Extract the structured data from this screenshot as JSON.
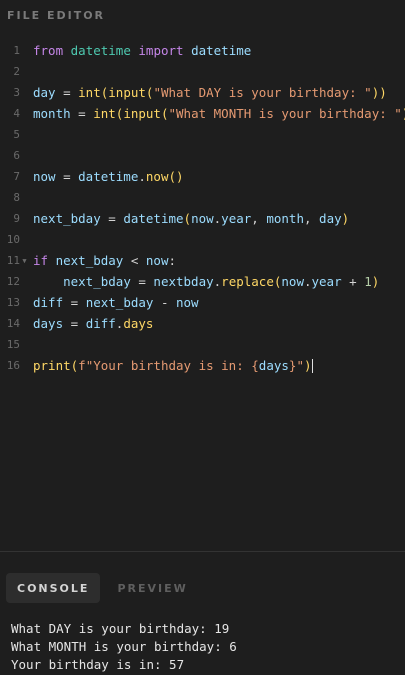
{
  "editor": {
    "header": "FILE EDITOR",
    "lines": [
      {
        "n": "1"
      },
      {
        "n": "2"
      },
      {
        "n": "3"
      },
      {
        "n": "4"
      },
      {
        "n": "5"
      },
      {
        "n": "6"
      },
      {
        "n": "7"
      },
      {
        "n": "8"
      },
      {
        "n": "9"
      },
      {
        "n": "10"
      },
      {
        "n": "11"
      },
      {
        "n": "12"
      },
      {
        "n": "13"
      },
      {
        "n": "14"
      },
      {
        "n": "15"
      },
      {
        "n": "16"
      }
    ],
    "tokens": {
      "l1": [
        "from",
        " ",
        "datetime",
        " ",
        "import",
        " ",
        "datetime"
      ],
      "l3": [
        "day",
        " = ",
        "int",
        "(",
        "input",
        "(",
        "\"What DAY is your birthday: \"",
        "))"
      ],
      "l4": [
        "month",
        " = ",
        "int",
        "(",
        "input",
        "(",
        "\"What MONTH is your birthday: \"",
        "))"
      ],
      "l7": [
        "now",
        " = ",
        "datetime",
        ".",
        "now",
        "()"
      ],
      "l9": [
        "next_bday",
        " = ",
        "datetime",
        "(",
        "now",
        ".",
        "year",
        ", ",
        "month",
        ", ",
        "day",
        ")"
      ],
      "l11": [
        "if",
        " ",
        "next_bday",
        " < ",
        "now",
        ":"
      ],
      "l12": [
        "    ",
        "next_bday",
        " = ",
        "nextbday",
        ".",
        "replace",
        "(",
        "now",
        ".",
        "year",
        " + ",
        "1",
        ")"
      ],
      "l13": [
        "diff",
        " = ",
        "next_bday",
        " - ",
        "now"
      ],
      "l14": [
        "days",
        " = ",
        "diff",
        ".",
        "days"
      ],
      "l16": [
        "print",
        "(",
        "f\"Your birthday is in: ",
        "{",
        "days",
        "}",
        "\"",
        ")"
      ]
    }
  },
  "console": {
    "tabs": [
      {
        "label": "CONSOLE",
        "active": true
      },
      {
        "label": "PREVIEW",
        "active": false
      }
    ],
    "output": [
      "What DAY is your birthday: 19",
      "What MONTH is your birthday: 6",
      "Your birthday is in: 57"
    ]
  },
  "colors": {
    "background": "#1e1e1e",
    "keyword": "#c586e8",
    "module": "#4ec9b0",
    "identifier": "#9cdcfe",
    "function": "#ffd866",
    "string": "#e59a72"
  }
}
